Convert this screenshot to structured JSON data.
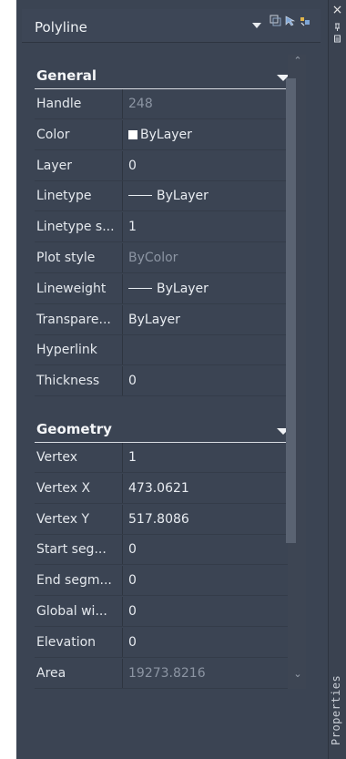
{
  "panel": {
    "title": "Polyline",
    "sidebar_label": "Properties"
  },
  "sections": {
    "general": {
      "label": "General",
      "rows": [
        {
          "key": "Handle",
          "value": "248",
          "dim": true
        },
        {
          "key": "Color",
          "value": "ByLayer",
          "swatch": "#ffffff"
        },
        {
          "key": "Layer",
          "value": "0"
        },
        {
          "key": "Linetype",
          "value": "ByLayer",
          "line_sample": true
        },
        {
          "key": "Linetype s...",
          "value": "1"
        },
        {
          "key": "Plot style",
          "value": "ByColor",
          "dim": true
        },
        {
          "key": "Lineweight",
          "value": "ByLayer",
          "line_sample": true
        },
        {
          "key": "Transpare...",
          "value": "ByLayer"
        },
        {
          "key": "Hyperlink",
          "value": ""
        },
        {
          "key": "Thickness",
          "value": "0"
        }
      ]
    },
    "geometry": {
      "label": "Geometry",
      "rows": [
        {
          "key": "Vertex",
          "value": "1"
        },
        {
          "key": "Vertex X",
          "value": "473.0621"
        },
        {
          "key": "Vertex Y",
          "value": "517.8086"
        },
        {
          "key": "Start seg...",
          "value": "0"
        },
        {
          "key": "End segm...",
          "value": "0"
        },
        {
          "key": "Global wi...",
          "value": "0"
        },
        {
          "key": "Elevation",
          "value": "0"
        },
        {
          "key": "Area",
          "value": "19273.8216",
          "dim": true
        }
      ]
    }
  },
  "colors": {
    "panel_bg": "#3b4453",
    "text": "#e8ecf1",
    "dim_text": "#8c95a3",
    "scroll_thumb": "#5a6372"
  }
}
